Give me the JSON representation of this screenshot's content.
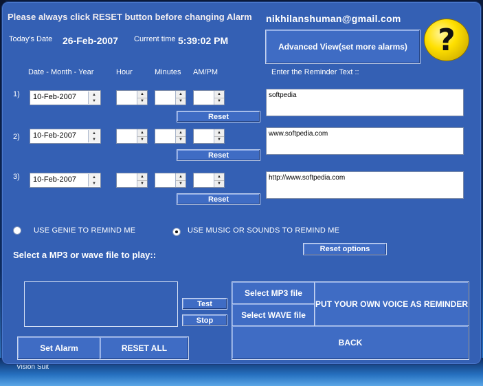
{
  "header": {
    "warning": "Please always click RESET button before changing Alarm",
    "email": "nikhilanshuman@gmail.com",
    "date_label": "Today's Date",
    "date_value": "26-Feb-2007",
    "time_label": "Current time",
    "time_value": "5:39:02 PM",
    "advanced_button": "Advanced View(set more alarms)",
    "help_glyph": "?"
  },
  "columns": {
    "date": "Date - Month - Year",
    "hour": "Hour",
    "minutes": "Minutes",
    "ampm": "AM/PM",
    "reminder": "Enter the Reminder Text  ::"
  },
  "alarms": [
    {
      "num": "1)",
      "date": "10-Feb-2007",
      "hour": "",
      "minutes": "",
      "ampm": "",
      "reset": "Reset",
      "text": "softpedia"
    },
    {
      "num": "2)",
      "date": "10-Feb-2007",
      "hour": "",
      "minutes": "",
      "ampm": "",
      "reset": "Reset",
      "text": "www.softpedia.com"
    },
    {
      "num": "3)",
      "date": "10-Feb-2007",
      "hour": "",
      "minutes": "",
      "ampm": "",
      "reset": "Reset",
      "text": "http://www.softpedia.com"
    }
  ],
  "options": {
    "genie": "USE GENIE TO REMIND ME",
    "music": "USE MUSIC OR SOUNDS TO REMIND ME",
    "selected": "music",
    "reset_options": "Reset options"
  },
  "file": {
    "label": "Select a MP3 or wave  file to play::",
    "test": "Test",
    "stop": "Stop",
    "select_mp3": "Select MP3  file",
    "select_wave": "Select WAVE  file",
    "own_voice": "PUT YOUR OWN VOICE AS REMINDER",
    "back": "BACK"
  },
  "actions": {
    "set_alarm": "Set Alarm",
    "reset_all": "RESET ALL"
  },
  "taskbar": {
    "text": "Vision Suit"
  }
}
